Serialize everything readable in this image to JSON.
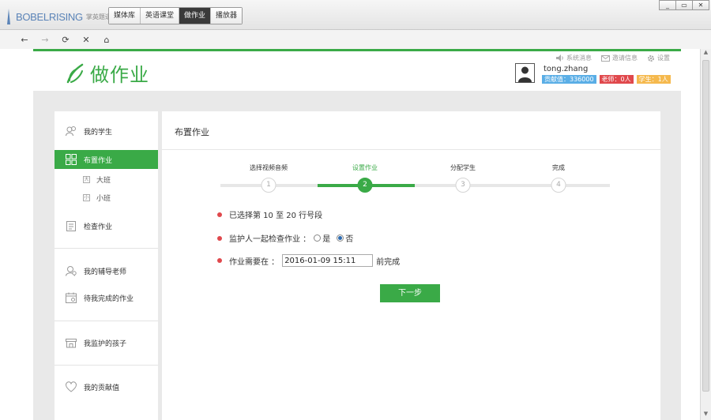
{
  "app": {
    "brand": "BOBELRISING",
    "brand_sub": "掌英题道 · 拼模",
    "tabs": [
      {
        "label": "媒体库"
      },
      {
        "label": "英语课堂"
      },
      {
        "label": "做作业",
        "active": true
      },
      {
        "label": "播放器"
      }
    ],
    "window_buttons": [
      "_",
      "▭",
      "✕"
    ]
  },
  "toolbar": {
    "back": "←",
    "forward": "→",
    "refresh": "⟳",
    "stop": "✕",
    "home": "⌂"
  },
  "header": {
    "page_title": "做作业",
    "links": {
      "messages": "系统消息",
      "invite": "邀请信息",
      "settings": "设置"
    },
    "user": {
      "name": "tong.zhang",
      "contribution": "贡献值：336000",
      "teachers": "老师：0人",
      "students": "学生：1人"
    }
  },
  "sidebar": {
    "items": [
      {
        "label": "我的学生",
        "icon": "users-icon"
      },
      {
        "label": "布置作业",
        "icon": "grid-icon",
        "active": true
      },
      {
        "label": "检查作业",
        "icon": "clipboard-icon"
      },
      {
        "label": "我的辅导老师",
        "icon": "teacher-icon"
      },
      {
        "label": "待我完成的作业",
        "icon": "calendar-icon"
      },
      {
        "label": "我监护的孩子",
        "icon": "store-icon"
      },
      {
        "label": "我的贡献值",
        "icon": "heart-icon"
      }
    ],
    "subitems": [
      {
        "label": "大班"
      },
      {
        "label": "小班"
      }
    ]
  },
  "main": {
    "title": "布置作业",
    "steps": [
      {
        "label": "选择视频音频",
        "num": "1"
      },
      {
        "label": "设置作业",
        "num": "2",
        "current": true
      },
      {
        "label": "分配学生",
        "num": "3"
      },
      {
        "label": "完成",
        "num": "4"
      }
    ],
    "selected_text": "已选择第 10 至 20 行号段",
    "guardian_label": "监护人一起检查作业 ：",
    "yes": "是",
    "no": "否",
    "guardian_value": "否",
    "deadline_label": "作业需要在 ：",
    "deadline_value": "2016-01-09 15:11",
    "deadline_suffix": "前完成",
    "next_button": "下一步"
  },
  "colors": {
    "accent": "#3aaa47",
    "badge_blue": "#5aaee6",
    "badge_red": "#e0484c",
    "badge_orange": "#f5b94e",
    "bullet": "#e0484c"
  }
}
